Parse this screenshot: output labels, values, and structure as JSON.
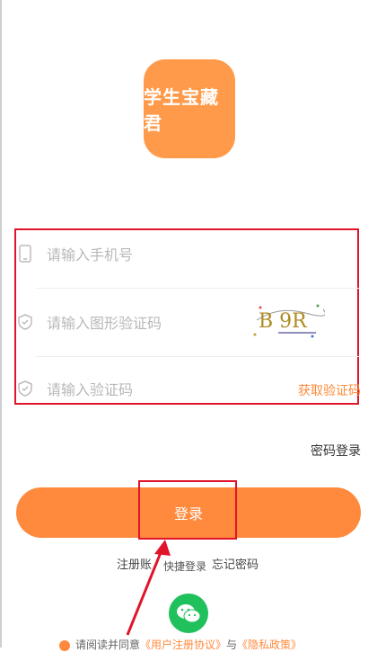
{
  "app": {
    "logo_text": "学生宝藏君"
  },
  "form": {
    "phone_placeholder": "请输入手机号",
    "captcha_placeholder": "请输入图形验证码",
    "code_placeholder": "请输入验证码",
    "captcha_text": "B 9R",
    "get_code_label": "获取验证码"
  },
  "links": {
    "password_login": "密码登录",
    "register": "注册账",
    "quick_login": "快捷登录",
    "forgot_password": "忘记密码"
  },
  "login_button": "登录",
  "agreement": {
    "prefix": "请阅读并同意",
    "user_agreement": "《用户注册协议》",
    "and": "与",
    "privacy_policy": "《隐私政策》"
  },
  "colors": {
    "accent": "#ff8a3d",
    "highlight": "#e0142a",
    "wechat": "#20c05c"
  }
}
